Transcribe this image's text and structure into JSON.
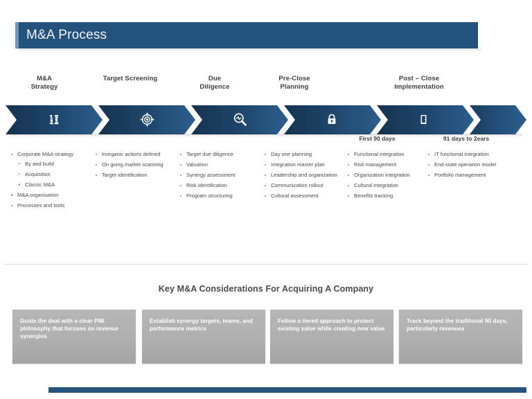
{
  "slide": {
    "title": "M&A Process",
    "section_title": "Key M&A Considerations For Acquiring A Company"
  },
  "colors": {
    "title_bar": "#23527c",
    "title_accent": "#6f95bd",
    "chevron_dark": "#1b3f63",
    "chevron_mid": "#26537f",
    "chevron_light": "#3a6f9e",
    "card_gray": "#b0b0b0",
    "bottom_bar": "#25537d",
    "text_gray": "#4a4a4a"
  },
  "phases": [
    {
      "id": "ma-strategy",
      "header": "M&A\nStrategy",
      "header_lines": [
        "M&A",
        "Strategy"
      ],
      "icon": "chess-pieces-icon",
      "sublabel": "",
      "bullets": [
        {
          "text": "Corporate M&A strategy",
          "children": [
            "By and build",
            "Acquisition",
            "Classic M&A"
          ]
        },
        {
          "text": "M&A organisation",
          "children": []
        },
        {
          "text": "Processes and tools",
          "children": []
        }
      ]
    },
    {
      "id": "target-screening",
      "header": "Target Screening",
      "header_lines": [
        "Target Screening"
      ],
      "icon": "target-crosshair-icon",
      "sublabel": "",
      "bullets": [
        {
          "text": "Inorganic  actions defined",
          "children": []
        },
        {
          "text": "On going market scanning",
          "children": []
        },
        {
          "text": "Target identification",
          "children": []
        }
      ]
    },
    {
      "id": "due-diligence",
      "header": "Due\nDiligence",
      "header_lines": [
        "Due",
        "Diligence"
      ],
      "icon": "magnifier-pulse-icon",
      "sublabel": "",
      "bullets": [
        {
          "text": "Target due diligence",
          "children": []
        },
        {
          "text": "Valuation",
          "children": []
        },
        {
          "text": "Synergy assessment",
          "children": []
        },
        {
          "text": "Risk identification",
          "children": []
        },
        {
          "text": "Program structuring",
          "children": []
        }
      ]
    },
    {
      "id": "pre-close-planning",
      "header": "Pre-Close\nPlanning",
      "header_lines": [
        "Pre-Close",
        "Planning"
      ],
      "icon": "padlock-icon",
      "sublabel": "",
      "bullets": [
        {
          "text": "Day one planning",
          "children": []
        },
        {
          "text": "Integration  master plan",
          "children": []
        },
        {
          "text": "Leadership and organization",
          "children": []
        },
        {
          "text": "Communication rollout",
          "children": []
        },
        {
          "text": "Cultural assessment",
          "children": []
        }
      ]
    },
    {
      "id": "post-close-first-90",
      "header": "",
      "header_lines": [],
      "icon": "",
      "sublabel": "First 90 days",
      "bullets": [
        {
          "text": "Functional integration",
          "children": []
        },
        {
          "text": "Risk management",
          "children": []
        },
        {
          "text": "Organization integration",
          "children": []
        },
        {
          "text": "Cultural integration",
          "children": []
        },
        {
          "text": "Benefits tracking",
          "children": []
        }
      ]
    },
    {
      "id": "post-close-91-plus",
      "header": "",
      "header_lines": [],
      "icon": "door-icon",
      "sublabel": "91 days to 2ears",
      "bullets": [
        {
          "text": "IT functional integration",
          "children": []
        },
        {
          "text": "End-state operation model",
          "children": []
        },
        {
          "text": "Portfolio management",
          "children": []
        }
      ]
    }
  ],
  "post_close_header": {
    "header_lines": [
      "Post – Close",
      "Implementation"
    ]
  },
  "considerations": [
    {
      "id": "card-pmi-philosophy",
      "text": "Guide  the deal with a clear PMI philosophy  that focuses on revenue synergies"
    },
    {
      "id": "card-synergy-targets",
      "text": "Establish  synergy targets, teams, and performance metrics"
    },
    {
      "id": "card-tiered-approach",
      "text": "Follow a tiered approach to protect existing value while creating new value"
    },
    {
      "id": "card-track-beyond-90",
      "text": "Track beyond  the traditional 90 days, particularly revenues"
    }
  ]
}
